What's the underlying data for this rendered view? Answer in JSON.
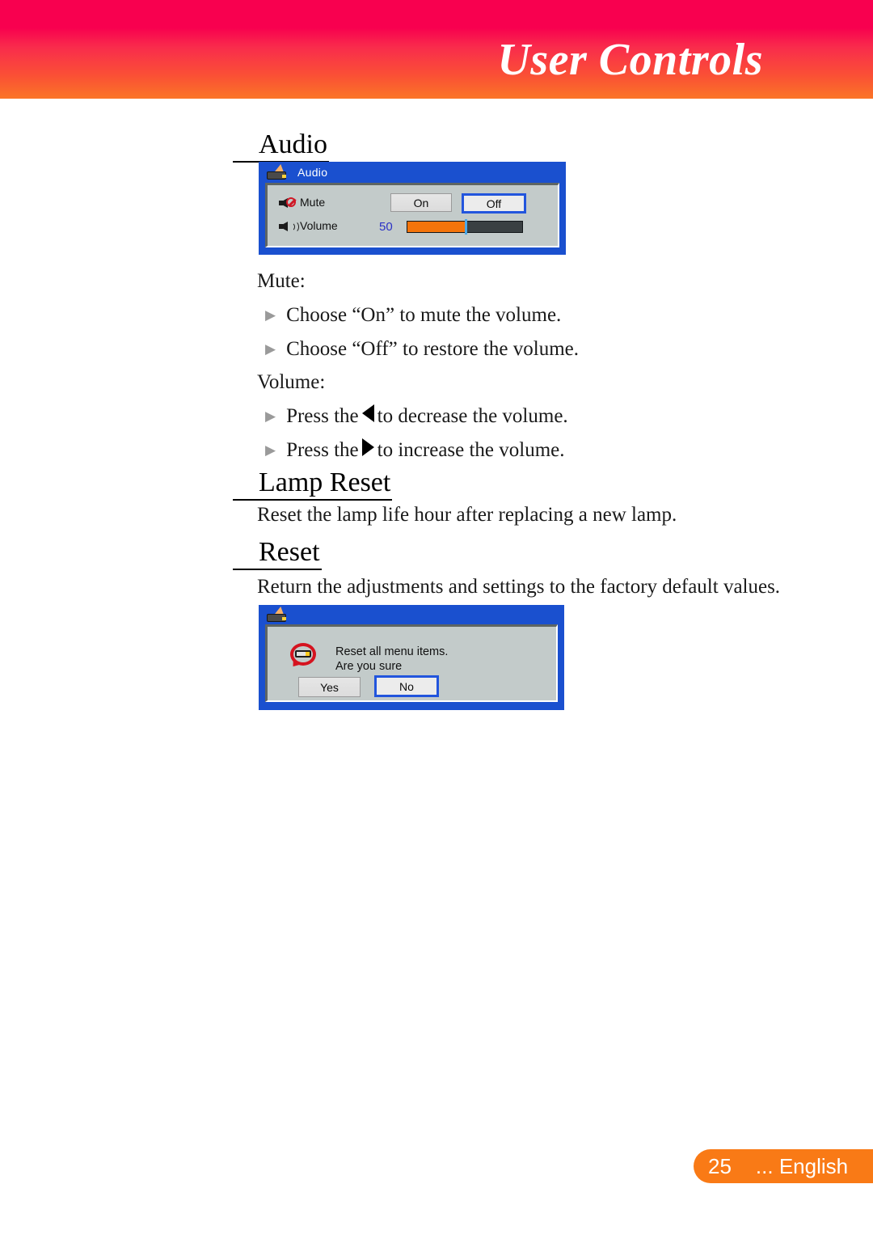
{
  "header": {
    "title": "User Controls",
    "gradient_top": "#f8004f",
    "gradient_bottom": "#fb7527"
  },
  "sections": {
    "audio": {
      "heading": "Audio",
      "mute_label": "Mute:",
      "mute_bullets": [
        "Choose “On” to mute the volume.",
        "Choose “Off” to restore the volume."
      ],
      "volume_label": "Volume:",
      "volume_bullets": [
        {
          "before": "Press the",
          "arrow": "left-triangle-icon",
          "after": "to decrease the volume."
        },
        {
          "before": "Press the",
          "arrow": "right-triangle-icon",
          "after": "to increase the volume."
        }
      ]
    },
    "lamp_reset": {
      "heading": "Lamp Reset",
      "body": "Reset the lamp life hour after replacing a new lamp."
    },
    "reset": {
      "heading": "Reset",
      "body": "Return the adjustments and settings to the factory default values."
    }
  },
  "audio_osd": {
    "title": "Audio",
    "title_icon": "projector-icon",
    "rows": [
      {
        "icon": "speaker-mute-icon",
        "label": "Mute",
        "buttons": [
          {
            "label": "On",
            "selected": false
          },
          {
            "label": "Off",
            "selected": true
          }
        ]
      },
      {
        "icon": "speaker-volume-icon",
        "label": "Volume",
        "value": "50",
        "slider": {
          "min": 0,
          "max": 100,
          "value": 50,
          "fill_color": "#f4740b",
          "track_color": "#3a4042",
          "cursor_color": "#4aa8e8"
        }
      }
    ],
    "frame_color": "#1a50cf",
    "panel_color": "#c3cbca",
    "selection_color": "#2255dd"
  },
  "reset_osd": {
    "title_icon": "projector-icon",
    "message_icon": "reset-circular-arrow-icon",
    "message": "Reset all menu items.\nAre you sure",
    "buttons": [
      {
        "label": "Yes",
        "selected": false
      },
      {
        "label": "No",
        "selected": true
      }
    ]
  },
  "footer": {
    "page_number": "25",
    "language": "... English",
    "pill_color": "#f97a16"
  }
}
